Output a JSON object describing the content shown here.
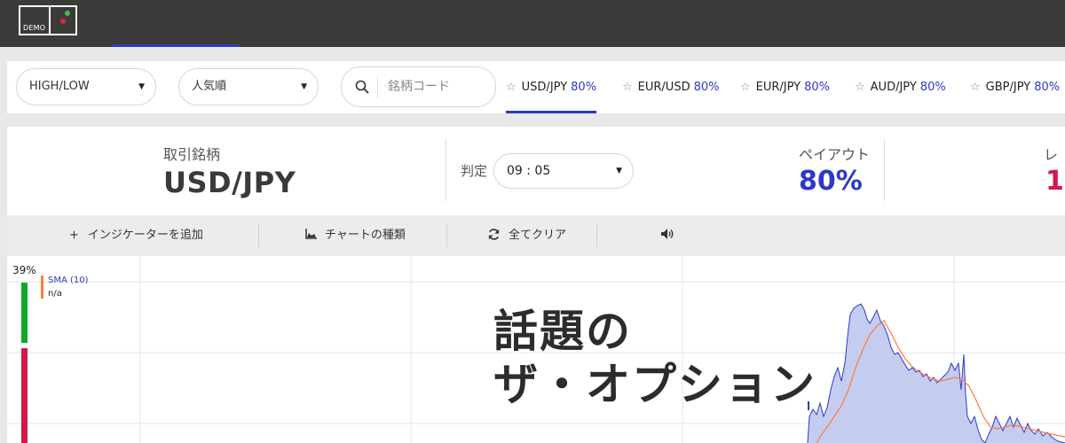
{
  "logo": {
    "text": "DEMO"
  },
  "filters": {
    "trade_type": "HIGH/LOW",
    "sort": "人気順",
    "search_placeholder": "銘柄コード"
  },
  "pairs": [
    {
      "name": "USD/JPY",
      "payout": "80%",
      "active": true
    },
    {
      "name": "EUR/USD",
      "payout": "80%",
      "active": false
    },
    {
      "name": "EUR/JPY",
      "payout": "80%",
      "active": false
    },
    {
      "name": "AUD/JPY",
      "payout": "80%",
      "active": false
    },
    {
      "name": "GBP/JPY",
      "payout": "80%",
      "active": false
    }
  ],
  "trade": {
    "symbol_label": "取引銘柄",
    "symbol": "USD/JPY",
    "expiry_label": "判定",
    "expiry": "09 : 05",
    "payout_label": "ペイアウト",
    "payout": "80%",
    "rate_label": "レ",
    "rate": "1"
  },
  "toolbar": {
    "add_indicator": "インジケーターを追加",
    "chart_type": "チャートの種類",
    "clear_all": "全てクリア"
  },
  "chart": {
    "high_pct": "39%",
    "indicator_name": "SMA (10)",
    "indicator_value": "n/a",
    "price_series": [
      [
        910,
        500
      ],
      [
        912,
        470
      ],
      [
        916,
        462
      ],
      [
        920,
        468
      ],
      [
        924,
        455
      ],
      [
        928,
        470
      ],
      [
        932,
        460
      ],
      [
        936,
        440
      ],
      [
        940,
        425
      ],
      [
        944,
        415
      ],
      [
        948,
        430
      ],
      [
        952,
        410
      ],
      [
        955,
        380
      ],
      [
        958,
        355
      ],
      [
        962,
        348
      ],
      [
        966,
        345
      ],
      [
        970,
        343
      ],
      [
        974,
        350
      ],
      [
        977,
        360
      ],
      [
        980,
        365
      ],
      [
        984,
        358
      ],
      [
        988,
        350
      ],
      [
        992,
        362
      ],
      [
        996,
        368
      ],
      [
        1000,
        378
      ],
      [
        1004,
        392
      ],
      [
        1008,
        400
      ],
      [
        1012,
        398
      ],
      [
        1016,
        405
      ],
      [
        1020,
        412
      ],
      [
        1024,
        418
      ],
      [
        1028,
        415
      ],
      [
        1032,
        420
      ],
      [
        1036,
        418
      ],
      [
        1040,
        425
      ],
      [
        1044,
        422
      ],
      [
        1048,
        430
      ],
      [
        1052,
        426
      ],
      [
        1056,
        432
      ],
      [
        1060,
        428
      ],
      [
        1064,
        424
      ],
      [
        1068,
        420
      ],
      [
        1072,
        410
      ],
      [
        1076,
        418
      ],
      [
        1080,
        410
      ],
      [
        1083,
        440
      ],
      [
        1086,
        400
      ],
      [
        1088,
        445
      ],
      [
        1090,
        470
      ],
      [
        1094,
        478
      ],
      [
        1098,
        470
      ],
      [
        1102,
        485
      ],
      [
        1106,
        496
      ],
      [
        1110,
        500
      ],
      [
        1114,
        490
      ],
      [
        1118,
        482
      ],
      [
        1122,
        470
      ],
      [
        1126,
        478
      ],
      [
        1130,
        486
      ],
      [
        1134,
        478
      ],
      [
        1138,
        470
      ],
      [
        1142,
        482
      ],
      [
        1146,
        472
      ],
      [
        1150,
        480
      ],
      [
        1154,
        488
      ],
      [
        1158,
        478
      ],
      [
        1162,
        486
      ],
      [
        1166,
        490
      ],
      [
        1170,
        484
      ],
      [
        1175,
        492
      ],
      [
        1180,
        488
      ],
      [
        1186,
        494
      ],
      [
        1192,
        498
      ],
      [
        1200,
        500
      ]
    ],
    "sma_series": [
      [
        920,
        500
      ],
      [
        926,
        490
      ],
      [
        932,
        482
      ],
      [
        940,
        470
      ],
      [
        948,
        458
      ],
      [
        956,
        440
      ],
      [
        964,
        415
      ],
      [
        972,
        395
      ],
      [
        980,
        378
      ],
      [
        988,
        368
      ],
      [
        996,
        362
      ],
      [
        1004,
        376
      ],
      [
        1012,
        392
      ],
      [
        1020,
        405
      ],
      [
        1028,
        414
      ],
      [
        1036,
        420
      ],
      [
        1044,
        424
      ],
      [
        1052,
        428
      ],
      [
        1060,
        430
      ],
      [
        1068,
        428
      ],
      [
        1076,
        426
      ],
      [
        1084,
        428
      ],
      [
        1092,
        436
      ],
      [
        1100,
        452
      ],
      [
        1108,
        470
      ],
      [
        1116,
        482
      ],
      [
        1124,
        484
      ],
      [
        1132,
        482
      ],
      [
        1140,
        480
      ],
      [
        1148,
        481
      ],
      [
        1156,
        483
      ],
      [
        1164,
        485
      ],
      [
        1172,
        487
      ],
      [
        1180,
        489
      ],
      [
        1190,
        491
      ],
      [
        1200,
        493
      ]
    ]
  },
  "overlay": {
    "line1": "話題の",
    "line2": "ザ・オプション"
  },
  "colors": {
    "topbar": "#3c3b39",
    "accent": "#2d38c9",
    "rate": "#d1194b",
    "sma": "#ff7a3d",
    "area_fill": "#c4cdf0",
    "area_stroke": "#2d38c9"
  }
}
